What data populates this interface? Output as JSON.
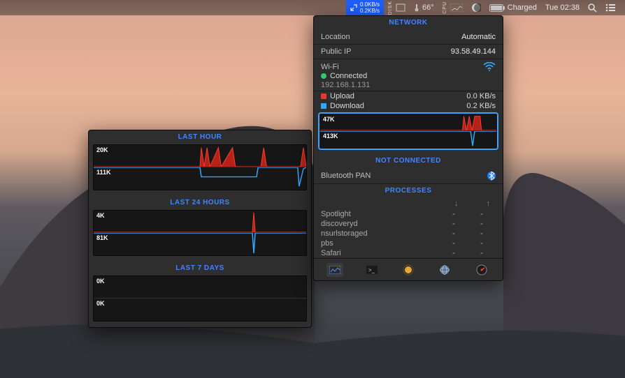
{
  "menubar": {
    "net_up": "0.0KB/s",
    "net_down": "0.2KB/s",
    "temp": "66°",
    "battery": "Charged",
    "clock": "Tue 02:38"
  },
  "history": {
    "title_hour": "LAST HOUR",
    "title_day": "LAST 24 HOURS",
    "title_week": "LAST 7 DAYS",
    "hour": {
      "up_max": "20K",
      "down_max": "111K"
    },
    "day": {
      "up_max": "4K",
      "down_max": "81K"
    },
    "week": {
      "up_max": "0K",
      "down_max": "0K"
    }
  },
  "network": {
    "title": "NETWORK",
    "location_label": "Location",
    "location_value": "Automatic",
    "publicip_label": "Public IP",
    "publicip_value": "93.58.49.144",
    "iface_name": "Wi-Fi",
    "iface_status": "Connected",
    "iface_ip": "192.168.1.131",
    "upload_label": "Upload",
    "upload_value": "0.0 KB/s",
    "download_label": "Download",
    "download_value": "0.2 KB/s",
    "live_up_max": "47K",
    "live_down_max": "413K",
    "not_connected": "NOT CONNECTED",
    "btpan": "Bluetooth PAN",
    "processes_title": "PROCESSES",
    "processes": [
      {
        "name": "Spotlight",
        "down": "-",
        "up": "-"
      },
      {
        "name": "discoveryd",
        "down": "-",
        "up": "-"
      },
      {
        "name": "nsurlstoraged",
        "down": "-",
        "up": "-"
      },
      {
        "name": "pbs",
        "down": "-",
        "up": "-"
      },
      {
        "name": "Safari",
        "down": "-",
        "up": "-"
      }
    ]
  },
  "chart_data": [
    {
      "type": "area",
      "title": "Last Hour Upload",
      "ylim": [
        0,
        20
      ],
      "unit": "K",
      "values_note": "mostly near-zero with several peaks ~20K between 50% and 80% of window and one at far right"
    },
    {
      "type": "area",
      "title": "Last Hour Download",
      "ylim": [
        0,
        111
      ],
      "unit": "K",
      "values_note": "flat at ~40% height between ~50% and 80%, spike near right edge"
    },
    {
      "type": "area",
      "title": "Last 24h Upload",
      "ylim": [
        0,
        4
      ],
      "unit": "K",
      "values_note": "single narrow spike at ~80%"
    },
    {
      "type": "area",
      "title": "Last 24h Download",
      "ylim": [
        0,
        81
      ],
      "unit": "K",
      "values_note": "single narrow spike at ~80%"
    },
    {
      "type": "area",
      "title": "Last 7d Upload",
      "ylim": [
        0,
        0
      ],
      "unit": "K",
      "values_note": "flat zero"
    },
    {
      "type": "area",
      "title": "Last 7d Download",
      "ylim": [
        0,
        0
      ],
      "unit": "K",
      "values_note": "flat zero"
    },
    {
      "type": "area",
      "title": "Live Upload",
      "ylim": [
        0,
        47
      ],
      "unit": "K",
      "values_note": "burst of peaks near right edge"
    },
    {
      "type": "area",
      "title": "Live Download",
      "ylim": [
        0,
        413
      ],
      "unit": "K",
      "values_note": "single sharp spike near right edge"
    }
  ]
}
